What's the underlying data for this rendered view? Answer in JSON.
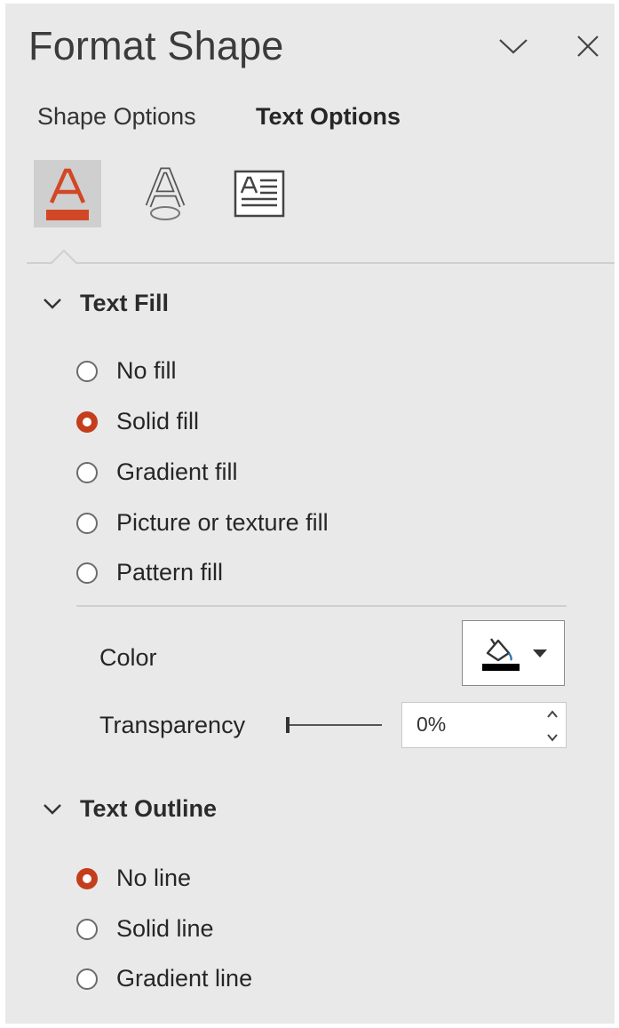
{
  "panel": {
    "title": "Format Shape"
  },
  "tabs": [
    {
      "label": "Shape Options",
      "active": false
    },
    {
      "label": "Text Options",
      "active": true
    }
  ],
  "icon_tabs": [
    {
      "icon": "text-fill-outline-icon",
      "selected": true
    },
    {
      "icon": "text-effects-icon",
      "selected": false
    },
    {
      "icon": "textbox-icon",
      "selected": false
    }
  ],
  "text_fill": {
    "header": "Text Fill",
    "options": [
      {
        "label": "No fill",
        "access_key": "N",
        "checked": false
      },
      {
        "label": "Solid fill",
        "access_key": "S",
        "checked": true
      },
      {
        "label": "Gradient fill",
        "access_key": "G",
        "checked": false
      },
      {
        "label": "Picture or texture fill",
        "access_key": "P",
        "checked": false
      },
      {
        "label": "Pattern fill",
        "access_key": "a",
        "checked": false
      }
    ],
    "color_label": "Color",
    "color_access_key": "C",
    "current_color": "#000000",
    "transparency_label": "Transparency",
    "transparency_access_key": "T",
    "transparency_value": "0%",
    "transparency_fraction": 0
  },
  "text_outline": {
    "header": "Text Outline",
    "options": [
      {
        "label": "No line",
        "access_key": "N",
        "checked": true
      },
      {
        "label": "Solid line",
        "access_key": "S",
        "checked": false
      },
      {
        "label": "Gradient line",
        "access_key": "G",
        "checked": false
      }
    ]
  },
  "colors": {
    "accent": "#c43e1c",
    "pane_bg": "#e9e9e9"
  }
}
